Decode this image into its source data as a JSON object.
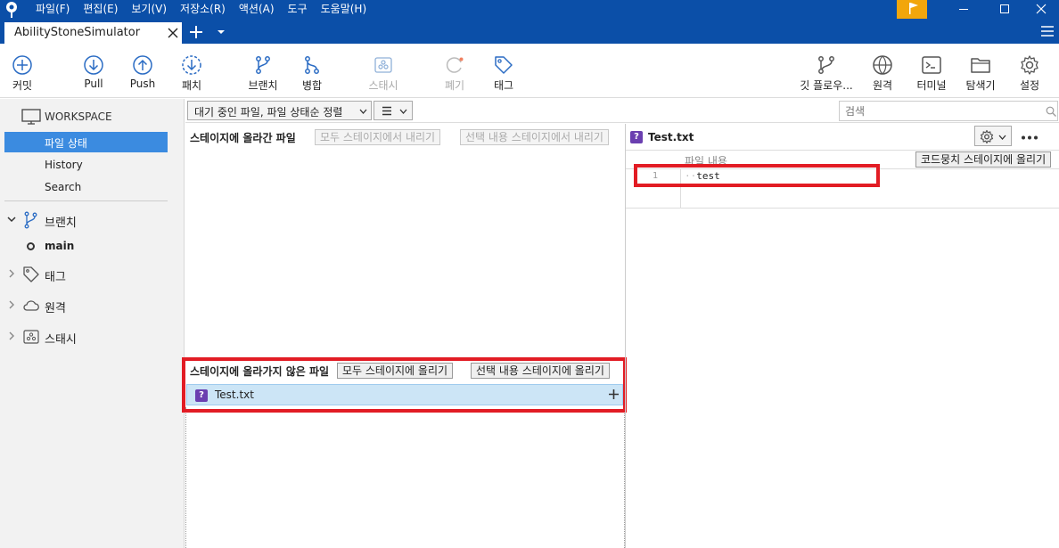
{
  "menu": [
    "파일(F)",
    "편집(E)",
    "보기(V)",
    "저장소(R)",
    "액션(A)",
    "도구",
    "도움말(H)"
  ],
  "tab": {
    "title": "AbilityStoneSimulator"
  },
  "toolbar": {
    "commit": "커밋",
    "pull": "Pull",
    "push": "Push",
    "fetch": "패치",
    "branch": "브랜치",
    "merge": "병합",
    "stash": "스태시",
    "discard": "폐기",
    "tag": "태그",
    "gitflow": "깃 플로우...",
    "remote": "원격",
    "terminal": "터미널",
    "explorer": "탐색기",
    "settings": "설정"
  },
  "sidebar": {
    "workspace": "WORKSPACE",
    "items": [
      "파일 상태",
      "History",
      "Search"
    ],
    "branches": "브랜치",
    "current_branch": "main",
    "tags": "태그",
    "remotes": "원격",
    "stashes": "스태시"
  },
  "filter": {
    "sort": "대기 중인 파일, 파일 상태순 정렬",
    "search_placeholder": "검색"
  },
  "staged": {
    "title": "스테이지에 올라간 파일",
    "unstage_all": "모두 스테이지에서 내리기",
    "unstage_selected": "선택 내용 스테이지에서 내리기"
  },
  "unstaged": {
    "title": "스테이지에 올라가지 않은 파일",
    "stage_all": "모두 스테이지에 올리기",
    "stage_selected": "선택 내용 스테이지에 올리기",
    "files": [
      {
        "name": "Test.txt",
        "status": "?"
      }
    ]
  },
  "diff": {
    "file": "Test.txt",
    "status": "?",
    "hunk_label": "파일 내용",
    "stage_hunk": "코드뭉치 스테이지에 올리기",
    "lines": [
      {
        "num": "1",
        "ws": "··",
        "text": "test"
      }
    ]
  },
  "colors": {
    "titlebar": "#0b4fa8",
    "selection": "#3b8be0",
    "highlight": "#e21c24",
    "untracked": "#6a3fb0"
  }
}
